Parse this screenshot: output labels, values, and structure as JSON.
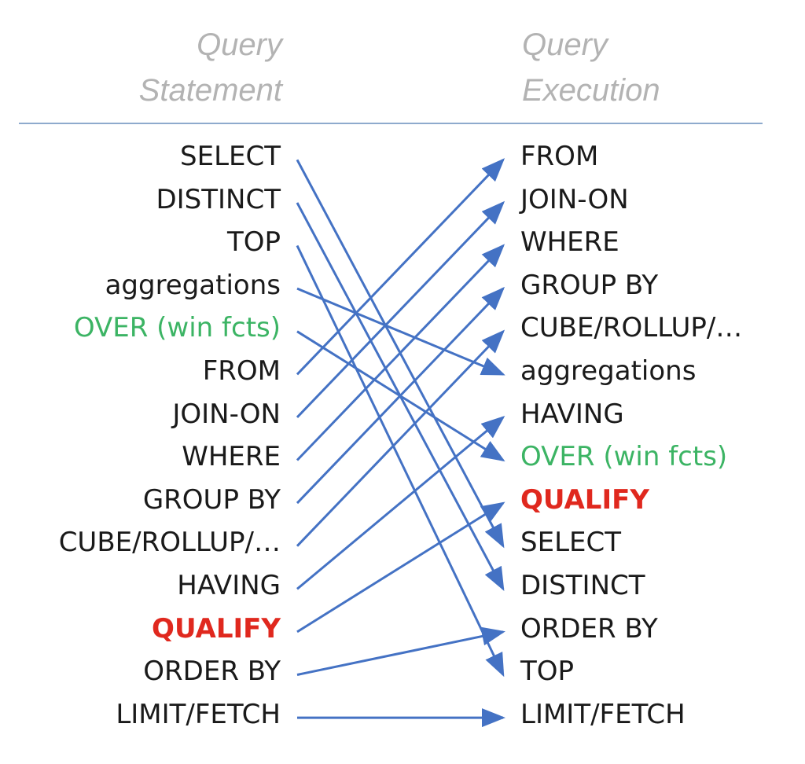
{
  "headers": {
    "statement": [
      "Query",
      "Statement"
    ],
    "execution": [
      "Query",
      "Execution"
    ]
  },
  "colors": {
    "header": "#b3b3b3",
    "text": "#1a1a1a",
    "window_function": "#3cb464",
    "qualify": "#e0281e",
    "arrow": "#4472c4",
    "divider": "#8eaacd"
  },
  "statement_order": [
    {
      "label": "SELECT"
    },
    {
      "label": "DISTINCT"
    },
    {
      "label": "TOP"
    },
    {
      "label": "aggregations"
    },
    {
      "label": "OVER (win fcts)",
      "style": "green"
    },
    {
      "label": "FROM"
    },
    {
      "label": "JOIN-ON"
    },
    {
      "label": "WHERE"
    },
    {
      "label": "GROUP BY"
    },
    {
      "label": "CUBE/ROLLUP/…"
    },
    {
      "label": "HAVING"
    },
    {
      "label": "QUALIFY",
      "style": "red"
    },
    {
      "label": "ORDER BY"
    },
    {
      "label": "LIMIT/FETCH"
    }
  ],
  "execution_order": [
    {
      "label": "FROM"
    },
    {
      "label": "JOIN-ON"
    },
    {
      "label": "WHERE"
    },
    {
      "label": "GROUP BY"
    },
    {
      "label": "CUBE/ROLLUP/…"
    },
    {
      "label": "aggregations"
    },
    {
      "label": "HAVING"
    },
    {
      "label": "OVER (win fcts)",
      "style": "green"
    },
    {
      "label": "QUALIFY",
      "style": "red"
    },
    {
      "label": "SELECT"
    },
    {
      "label": "DISTINCT"
    },
    {
      "label": "ORDER BY"
    },
    {
      "label": "TOP"
    },
    {
      "label": "LIMIT/FETCH"
    }
  ],
  "mappings": [
    {
      "from": "SELECT",
      "to": "SELECT"
    },
    {
      "from": "DISTINCT",
      "to": "DISTINCT"
    },
    {
      "from": "TOP",
      "to": "TOP"
    },
    {
      "from": "aggregations",
      "to": "aggregations"
    },
    {
      "from": "OVER (win fcts)",
      "to": "OVER (win fcts)"
    },
    {
      "from": "FROM",
      "to": "FROM"
    },
    {
      "from": "JOIN-ON",
      "to": "JOIN-ON"
    },
    {
      "from": "WHERE",
      "to": "WHERE"
    },
    {
      "from": "GROUP BY",
      "to": "GROUP BY"
    },
    {
      "from": "CUBE/ROLLUP/…",
      "to": "CUBE/ROLLUP/…"
    },
    {
      "from": "HAVING",
      "to": "HAVING"
    },
    {
      "from": "QUALIFY",
      "to": "QUALIFY"
    },
    {
      "from": "ORDER BY",
      "to": "ORDER BY"
    },
    {
      "from": "LIMIT/FETCH",
      "to": "LIMIT/FETCH"
    }
  ]
}
